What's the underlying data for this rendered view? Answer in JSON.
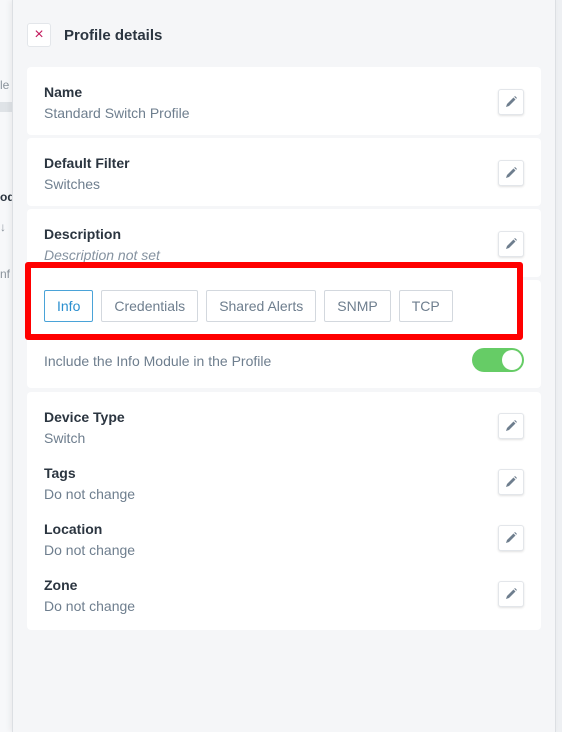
{
  "background": {
    "fragments": [
      "le",
      "od",
      "↓",
      "nf"
    ]
  },
  "panel": {
    "title": "Profile details",
    "close_icon": "×"
  },
  "fields": {
    "name": {
      "label": "Name",
      "value": "Standard Switch Profile"
    },
    "default_filter": {
      "label": "Default Filter",
      "value": "Switches"
    },
    "description": {
      "label": "Description",
      "value": "Description not set"
    }
  },
  "tabs": [
    {
      "label": "Info",
      "active": true
    },
    {
      "label": "Credentials",
      "active": false
    },
    {
      "label": "Shared Alerts",
      "active": false
    },
    {
      "label": "SNMP",
      "active": false
    },
    {
      "label": "TCP",
      "active": false
    }
  ],
  "info_module": {
    "toggle_label": "Include the Info Module in the Profile",
    "enabled": true
  },
  "details": {
    "device_type": {
      "label": "Device Type",
      "value": "Switch"
    },
    "tags": {
      "label": "Tags",
      "value": "Do not change"
    },
    "location": {
      "label": "Location",
      "value": "Do not change"
    },
    "zone": {
      "label": "Zone",
      "value": "Do not change"
    }
  },
  "colors": {
    "accent": "#2a8fcf",
    "toggle_on": "#66cc66",
    "highlight": "#ff0000",
    "close": "#c2185b"
  }
}
